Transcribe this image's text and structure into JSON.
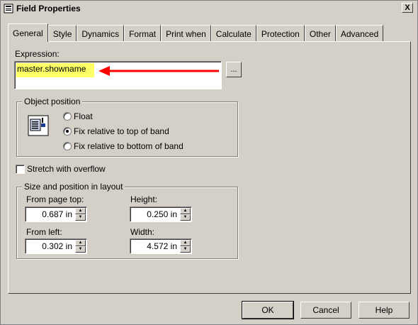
{
  "window": {
    "title": "Field Properties",
    "close_label": "X"
  },
  "tabs": [
    {
      "label": "General",
      "active": true
    },
    {
      "label": "Style"
    },
    {
      "label": "Dynamics"
    },
    {
      "label": "Format"
    },
    {
      "label": "Print when"
    },
    {
      "label": "Calculate"
    },
    {
      "label": "Protection"
    },
    {
      "label": "Other"
    },
    {
      "label": "Advanced"
    }
  ],
  "expression": {
    "label": "Expression:",
    "value": "master.showname",
    "browse_label": "...",
    "highlight_color": "#ffff66",
    "arrow_color": "#ff0000"
  },
  "object_position": {
    "title": "Object position",
    "icon": "object-position-icon",
    "options": [
      {
        "label": "Float",
        "selected": false
      },
      {
        "label": "Fix relative to top of band",
        "selected": true
      },
      {
        "label": "Fix relative to bottom of band",
        "selected": false
      }
    ]
  },
  "stretch_overflow": {
    "label": "Stretch with overflow",
    "checked": false
  },
  "size_position": {
    "title": "Size and position in layout",
    "from_page_top": {
      "label": "From page top:",
      "value": "0.687 in"
    },
    "height": {
      "label": "Height:",
      "value": "0.250 in"
    },
    "from_left": {
      "label": "From left:",
      "value": "0.302 in"
    },
    "width": {
      "label": "Width:",
      "value": "4.572 in"
    }
  },
  "buttons": {
    "ok": "OK",
    "cancel": "Cancel",
    "help": "Help"
  }
}
